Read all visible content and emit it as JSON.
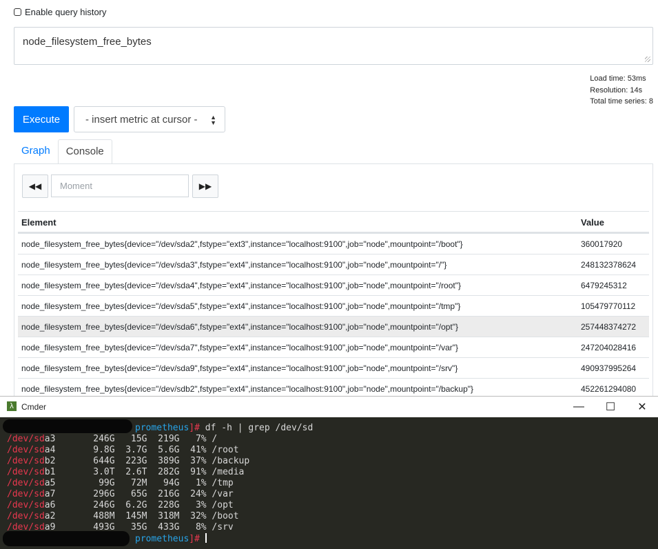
{
  "history": {
    "label": "Enable query history",
    "checked": false
  },
  "query": {
    "expression": "node_filesystem_free_bytes"
  },
  "stats": {
    "load_time": "Load time: 53ms",
    "resolution": "Resolution: 14s",
    "total_series": "Total time series: 8"
  },
  "toolbar": {
    "execute_label": "Execute",
    "insert_metric_label": "- insert metric at cursor -"
  },
  "tabs": [
    {
      "label": "Graph",
      "active": false
    },
    {
      "label": "Console",
      "active": true
    }
  ],
  "console": {
    "moment_placeholder": "Moment"
  },
  "table": {
    "headers": [
      "Element",
      "Value"
    ],
    "rows": [
      {
        "element": "node_filesystem_free_bytes{device=\"/dev/sda2\",fstype=\"ext3\",instance=\"localhost:9100\",job=\"node\",mountpoint=\"/boot\"}",
        "value": "360017920"
      },
      {
        "element": "node_filesystem_free_bytes{device=\"/dev/sda3\",fstype=\"ext4\",instance=\"localhost:9100\",job=\"node\",mountpoint=\"/\"}",
        "value": "248132378624"
      },
      {
        "element": "node_filesystem_free_bytes{device=\"/dev/sda4\",fstype=\"ext4\",instance=\"localhost:9100\",job=\"node\",mountpoint=\"/root\"}",
        "value": "6479245312"
      },
      {
        "element": "node_filesystem_free_bytes{device=\"/dev/sda5\",fstype=\"ext4\",instance=\"localhost:9100\",job=\"node\",mountpoint=\"/tmp\"}",
        "value": "105479770112"
      },
      {
        "element": "node_filesystem_free_bytes{device=\"/dev/sda6\",fstype=\"ext4\",instance=\"localhost:9100\",job=\"node\",mountpoint=\"/opt\"}",
        "value": "257448374272"
      },
      {
        "element": "node_filesystem_free_bytes{device=\"/dev/sda7\",fstype=\"ext4\",instance=\"localhost:9100\",job=\"node\",mountpoint=\"/var\"}",
        "value": "247204028416"
      },
      {
        "element": "node_filesystem_free_bytes{device=\"/dev/sda9\",fstype=\"ext4\",instance=\"localhost:9100\",job=\"node\",mountpoint=\"/srv\"}",
        "value": "490937995264"
      },
      {
        "element": "node_filesystem_free_bytes{device=\"/dev/sdb2\",fstype=\"ext4\",instance=\"localhost:9100\",job=\"node\",mountpoint=\"/backup\"}",
        "value": "452261294080"
      }
    ]
  },
  "cmder": {
    "title": "Cmder",
    "controls": {
      "minimize": "—",
      "maximize": "☐",
      "close": "✕"
    },
    "prompt_host": "prometheus",
    "prompt_suffix": "]#",
    "command": " df -h | grep /dev/sd",
    "df_rows": [
      {
        "dev": "/dev/sd",
        "suffix": "a3",
        "rest": "       246G   15G  219G   7% /"
      },
      {
        "dev": "/dev/sd",
        "suffix": "a4",
        "rest": "       9.8G  3.7G  5.6G  41% /root"
      },
      {
        "dev": "/dev/sd",
        "suffix": "b2",
        "rest": "       644G  223G  389G  37% /backup"
      },
      {
        "dev": "/dev/sd",
        "suffix": "b1",
        "rest": "       3.0T  2.6T  282G  91% /media"
      },
      {
        "dev": "/dev/sd",
        "suffix": "a5",
        "rest": "        99G   72M   94G   1% /tmp"
      },
      {
        "dev": "/dev/sd",
        "suffix": "a7",
        "rest": "       296G   65G  216G  24% /var"
      },
      {
        "dev": "/dev/sd",
        "suffix": "a6",
        "rest": "       246G  6.2G  228G   3% /opt"
      },
      {
        "dev": "/dev/sd",
        "suffix": "a2",
        "rest": "       488M  145M  318M  32% /boot"
      },
      {
        "dev": "/dev/sd",
        "suffix": "a9",
        "rest": "       493G   35G  433G   8% /srv"
      }
    ]
  },
  "colors": {
    "accent": "#007bff",
    "terminal_bg": "#272822",
    "terminal_red": "#e8384f",
    "terminal_blue": "#28a4e8"
  }
}
